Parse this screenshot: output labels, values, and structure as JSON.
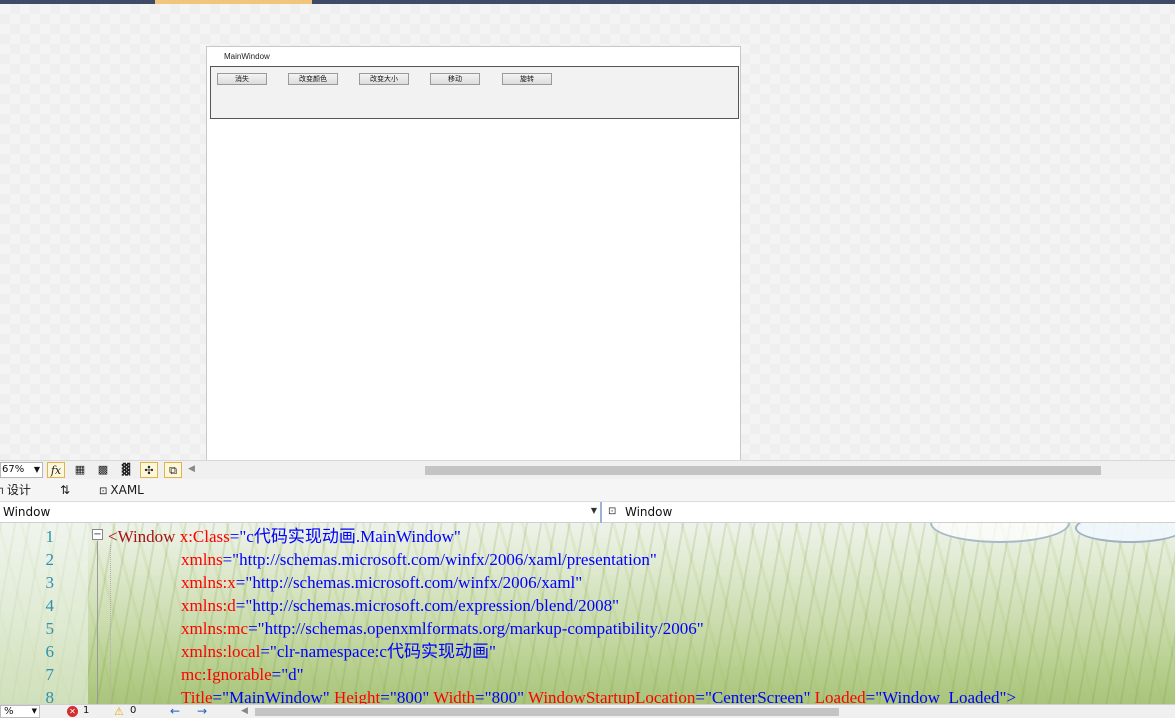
{
  "designer": {
    "window_title": "MainWindow",
    "buttons": [
      "消失",
      "改变颜色",
      "改变大小",
      "移动",
      "旋转"
    ]
  },
  "toolbar": {
    "zoom": "67%",
    "icons": [
      "fx-icon",
      "grid-icon",
      "snap-grid-icon",
      "checker-icon",
      "snap-lines-icon",
      "artboard-icon"
    ]
  },
  "tabs": {
    "design": "设计",
    "swap": "⇅",
    "xaml": "XAML"
  },
  "nav": {
    "left_selector": "Window",
    "right_selector": "Window"
  },
  "editor": {
    "line_numbers": [
      "1",
      "2",
      "3",
      "4",
      "5",
      "6",
      "7",
      "8"
    ],
    "lines": [
      {
        "tag": "<Window",
        "attr": "x:Class",
        "eq": "=",
        "val": "\"c代码实现动画.MainWindow\""
      },
      {
        "attr": "xmlns",
        "eq": "=",
        "val": "\"http://schemas.microsoft.com/winfx/2006/xaml/presentation\""
      },
      {
        "attr": "xmlns:x",
        "eq": "=",
        "val": "\"http://schemas.microsoft.com/winfx/2006/xaml\""
      },
      {
        "attr": "xmlns:d",
        "eq": "=",
        "val": "\"http://schemas.microsoft.com/expression/blend/2008\""
      },
      {
        "attr": "xmlns:mc",
        "eq": "=",
        "val": "\"http://schemas.openxmlformats.org/markup-compatibility/2006\""
      },
      {
        "attr": "xmlns:local",
        "eq": "=",
        "val": "\"clr-namespace:c代码实现动画\""
      },
      {
        "attr": "mc:Ignorable",
        "eq": "=",
        "val": "\"d\""
      },
      {
        "a1": "Title",
        "v1": "\"MainWindow\"",
        "a2": "Height",
        "v2": "\"800\"",
        "a3": "Width",
        "v3": "\"800\"",
        "a4": "WindowStartupLocation",
        "v4": "\"CenterScreen\"",
        "a5": "Loaded",
        "v5": "\"Window_Loaded\">"
      }
    ]
  },
  "status": {
    "zoom": "%",
    "errors": "1",
    "warnings": "0"
  }
}
